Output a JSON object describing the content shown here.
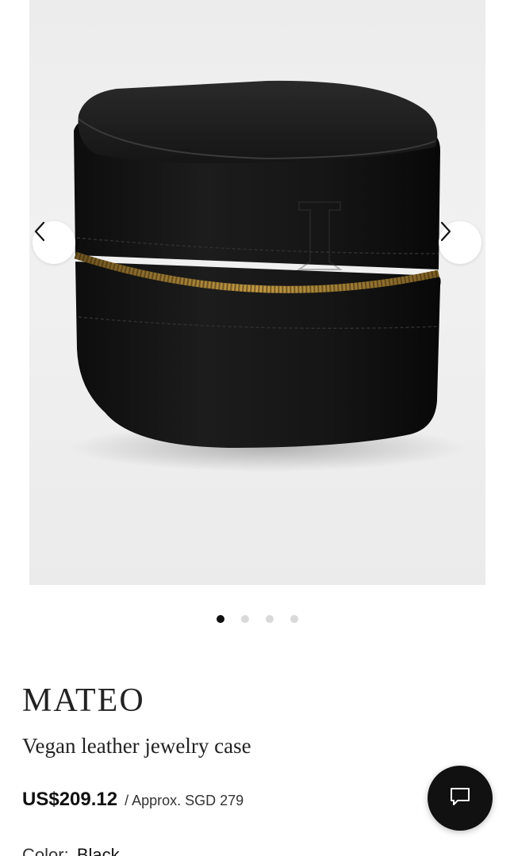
{
  "gallery": {
    "image_alt": "Black vegan leather square jewelry case with gold zipper",
    "prev_icon": "chevron-left-icon",
    "next_icon": "chevron-right-icon",
    "slide_count": 4,
    "active_slide": 1
  },
  "product": {
    "brand": "MATEO",
    "title": "Vegan leather jewelry case",
    "price": "US$209.12",
    "approx_price": "/ Approx. SGD 279",
    "color_label": "Color:",
    "color_value": "Black"
  },
  "chat": {
    "icon": "chat-bubble-icon"
  },
  "colors": {
    "accent": "#111111",
    "dot_inactive": "#d9d9d9",
    "zipper_gold": "#b28a3a"
  }
}
